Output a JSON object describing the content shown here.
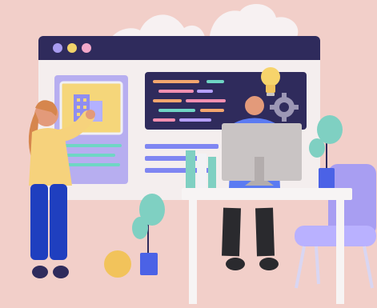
{
  "colors": {
    "background": "#f2cfc9",
    "cloud": "#f7f1f2",
    "window_frame": "#f4eeee",
    "window_titlebar": "#2f2b5c",
    "dot_purple": "#a89cf0",
    "dot_yellow": "#f1d36a",
    "dot_pink": "#f2a8c9",
    "card_border": "#b7aef0",
    "card_inner": "#f5d67a",
    "code_panel": "#2f2b5c",
    "code_pink": "#f28fb0",
    "code_orange": "#f3a66e",
    "code_teal": "#6fd6c4",
    "code_violet": "#b5a0ff",
    "bar_blue": "#7f86f2",
    "bulb": "#f7d46b",
    "gear": "#9c97b5",
    "desk": "#f7f4f4",
    "monitor": "#c9c4c4",
    "chair": "#a89ef2",
    "plant_leaf": "#7fd0c2",
    "plant_pot": "#4b62e6",
    "ball": "#f2c35b",
    "woman_shirt": "#f6d27c",
    "woman_pants": "#1f3fbf",
    "woman_hair": "#d6864d",
    "man_shirt": "#5b7bf2",
    "man_pants": "#2a2a2e",
    "skin": "#e39a7a"
  },
  "icons": {
    "window_dots": [
      "dot-purple-icon",
      "dot-yellow-icon",
      "dot-pink-icon"
    ],
    "lightbulb": "lightbulb-icon",
    "gear": "gear-icon",
    "building": "building-icon"
  }
}
